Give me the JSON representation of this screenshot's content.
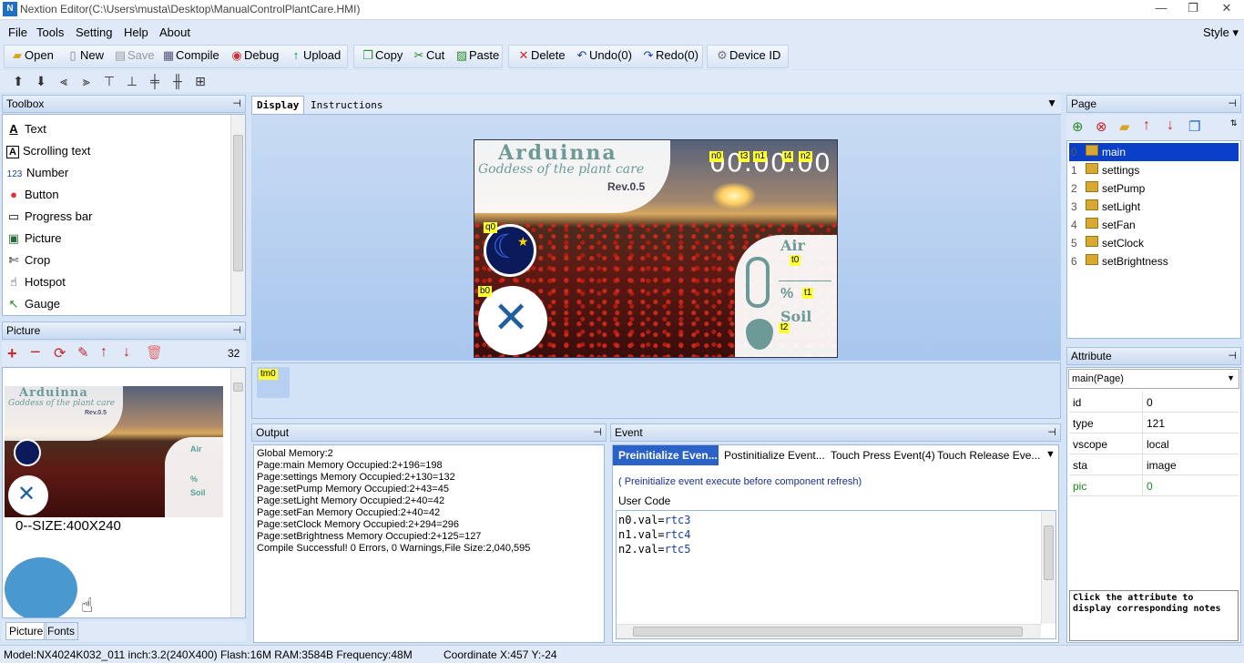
{
  "window": {
    "title": "Nextion Editor(C:\\Users\\musta\\Desktop\\ManualControlPlantCare.HMI)",
    "app_icon_text": "N",
    "controls": [
      "—",
      "❐",
      "✕"
    ]
  },
  "menu": [
    "File",
    "Tools",
    "Setting",
    "Help",
    "About"
  ],
  "style_menu": "Style",
  "toolbar": {
    "open": "Open",
    "new": "New",
    "save": "Save",
    "compile": "Compile",
    "debug": "Debug",
    "upload": "Upload",
    "copy": "Copy",
    "cut": "Cut",
    "paste": "Paste",
    "delete": "Delete",
    "undo": "Undo(0)",
    "redo": "Redo(0)",
    "device_id": "Device  ID"
  },
  "toolbox": {
    "header": "Toolbox",
    "items": [
      "Text",
      "Scrolling text",
      "Number",
      "Button",
      "Progress bar",
      "Picture",
      "Crop",
      "Hotspot",
      "Gauge"
    ],
    "icons": [
      "A",
      "A",
      "123",
      "●",
      "▭",
      "▣",
      "✄",
      "☝",
      "↖"
    ]
  },
  "picture_panel": {
    "header": "Picture",
    "count": "32",
    "size_label": "0--SIZE:400X240",
    "thumb_title": "Arduinna",
    "thumb_subtitle": "Goddess of the plant care",
    "thumb_rev": "Rev.0.5",
    "thumb_air": "Air",
    "thumb_percent": "%",
    "thumb_soil": "Soil",
    "tabs": [
      "Picture",
      "Fonts"
    ]
  },
  "display": {
    "tabs": [
      "Display",
      "Instructions"
    ],
    "screen": {
      "title": "Arduinna",
      "subtitle": "Goddess of the plant care",
      "rev": "Rev.0.5",
      "clock": "00:00:00",
      "air": "Air",
      "percent": "%",
      "soil": "Soil",
      "tags": [
        "n0",
        "t3",
        "n1",
        "t4",
        "n2",
        "q0",
        "b0",
        "t0",
        "t1",
        "t2"
      ]
    },
    "timer_tag": "tm0"
  },
  "output": {
    "header": "Output",
    "lines": [
      "Global Memory:2",
      "Page:main Memory Occupied:2+196=198",
      "Page:settings Memory Occupied:2+130=132",
      "Page:setPump Memory Occupied:2+43=45",
      "Page:setLight Memory Occupied:2+40=42",
      "Page:setFan Memory Occupied:2+40=42",
      "Page:setClock Memory Occupied:2+294=296",
      "Page:setBrightness Memory Occupied:2+125=127",
      "Compile Successful! 0 Errors, 0 Warnings,File Size:2,040,595"
    ]
  },
  "event": {
    "header": "Event",
    "tabs": [
      "Preinitialize Even...",
      "Postinitialize Event...",
      "Touch Press Event(4)",
      "Touch Release Eve..."
    ],
    "hint": "( Preinitialize event execute before component refresh)",
    "user_code_label": "User Code",
    "code": [
      {
        "var": "n0.val",
        "eq": "=",
        "val": "rtc3"
      },
      {
        "var": "n1.val",
        "eq": "=",
        "val": "rtc4"
      },
      {
        "var": "n2.val",
        "eq": "=",
        "val": "rtc5"
      }
    ]
  },
  "page_panel": {
    "header": "Page",
    "pages": [
      "main",
      "settings",
      "setPump",
      "setLight",
      "setFan",
      "setClock",
      "setBrightness"
    ],
    "indices": [
      "0",
      "1",
      "2",
      "3",
      "4",
      "5",
      "6"
    ],
    "selected": 0
  },
  "attribute": {
    "header": "Attribute",
    "selector": "main(Page)",
    "rows": [
      {
        "key": "id",
        "value": "0"
      },
      {
        "key": "type",
        "value": "121"
      },
      {
        "key": "vscope",
        "value": "local"
      },
      {
        "key": "sta",
        "value": "image"
      },
      {
        "key": "pic",
        "value": "0"
      }
    ],
    "note": "Click the attribute to display corresponding notes"
  },
  "status": {
    "model": "Model:NX4024K032_011  inch:3.2(240X400) Flash:16M RAM:3584B Frequency:48M",
    "coordinate": "Coordinate X:457  Y:-24"
  },
  "colors": {
    "accent": "#1f6fc5",
    "selection": "#0a3fc8",
    "panel_bg": "#d6e4f7",
    "tag_yellow": "#ffff33",
    "icon_teal": "#5a9e9a"
  }
}
